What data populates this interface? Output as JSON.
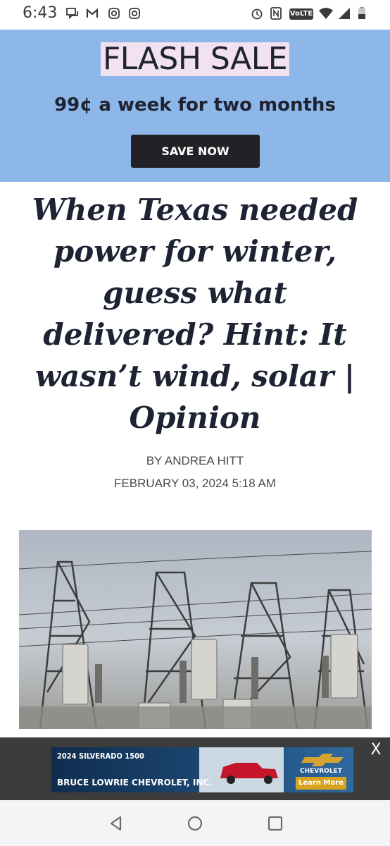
{
  "status_bar": {
    "time": "6:43",
    "network_badge": "VoLTE",
    "icons": [
      "chat-icon",
      "gmail-icon",
      "instagram-icon",
      "instagram-icon",
      "alarm-icon",
      "nfc-icon",
      "wifi-icon",
      "signal-icon",
      "battery-icon"
    ]
  },
  "promo": {
    "title": "FLASH SALE",
    "subtitle": "99¢ a week for two months",
    "button_label": "SAVE NOW",
    "colors": {
      "background": "#8db7e8",
      "title_highlight": "#f2e2f0",
      "button": "#222226"
    }
  },
  "article": {
    "headline": "When Texas needed power for winter, guess what delivered? Hint: It wasn’t wind, solar | Opinion",
    "byline": "BY ANDREA HITT",
    "date": "FEBRUARY 03, 2024 5:18 AM",
    "image": "electrical substation towers and transformers"
  },
  "ad": {
    "model": "2024 SILVERADO 1500",
    "dealer": "BRUCE LOWRIE CHEVROLET, INC.",
    "brand": "CHEVROLET",
    "cta": "Learn More",
    "close_label": "X"
  },
  "nav_bar": {
    "buttons": [
      "back-icon",
      "home-icon",
      "recents-icon"
    ]
  }
}
